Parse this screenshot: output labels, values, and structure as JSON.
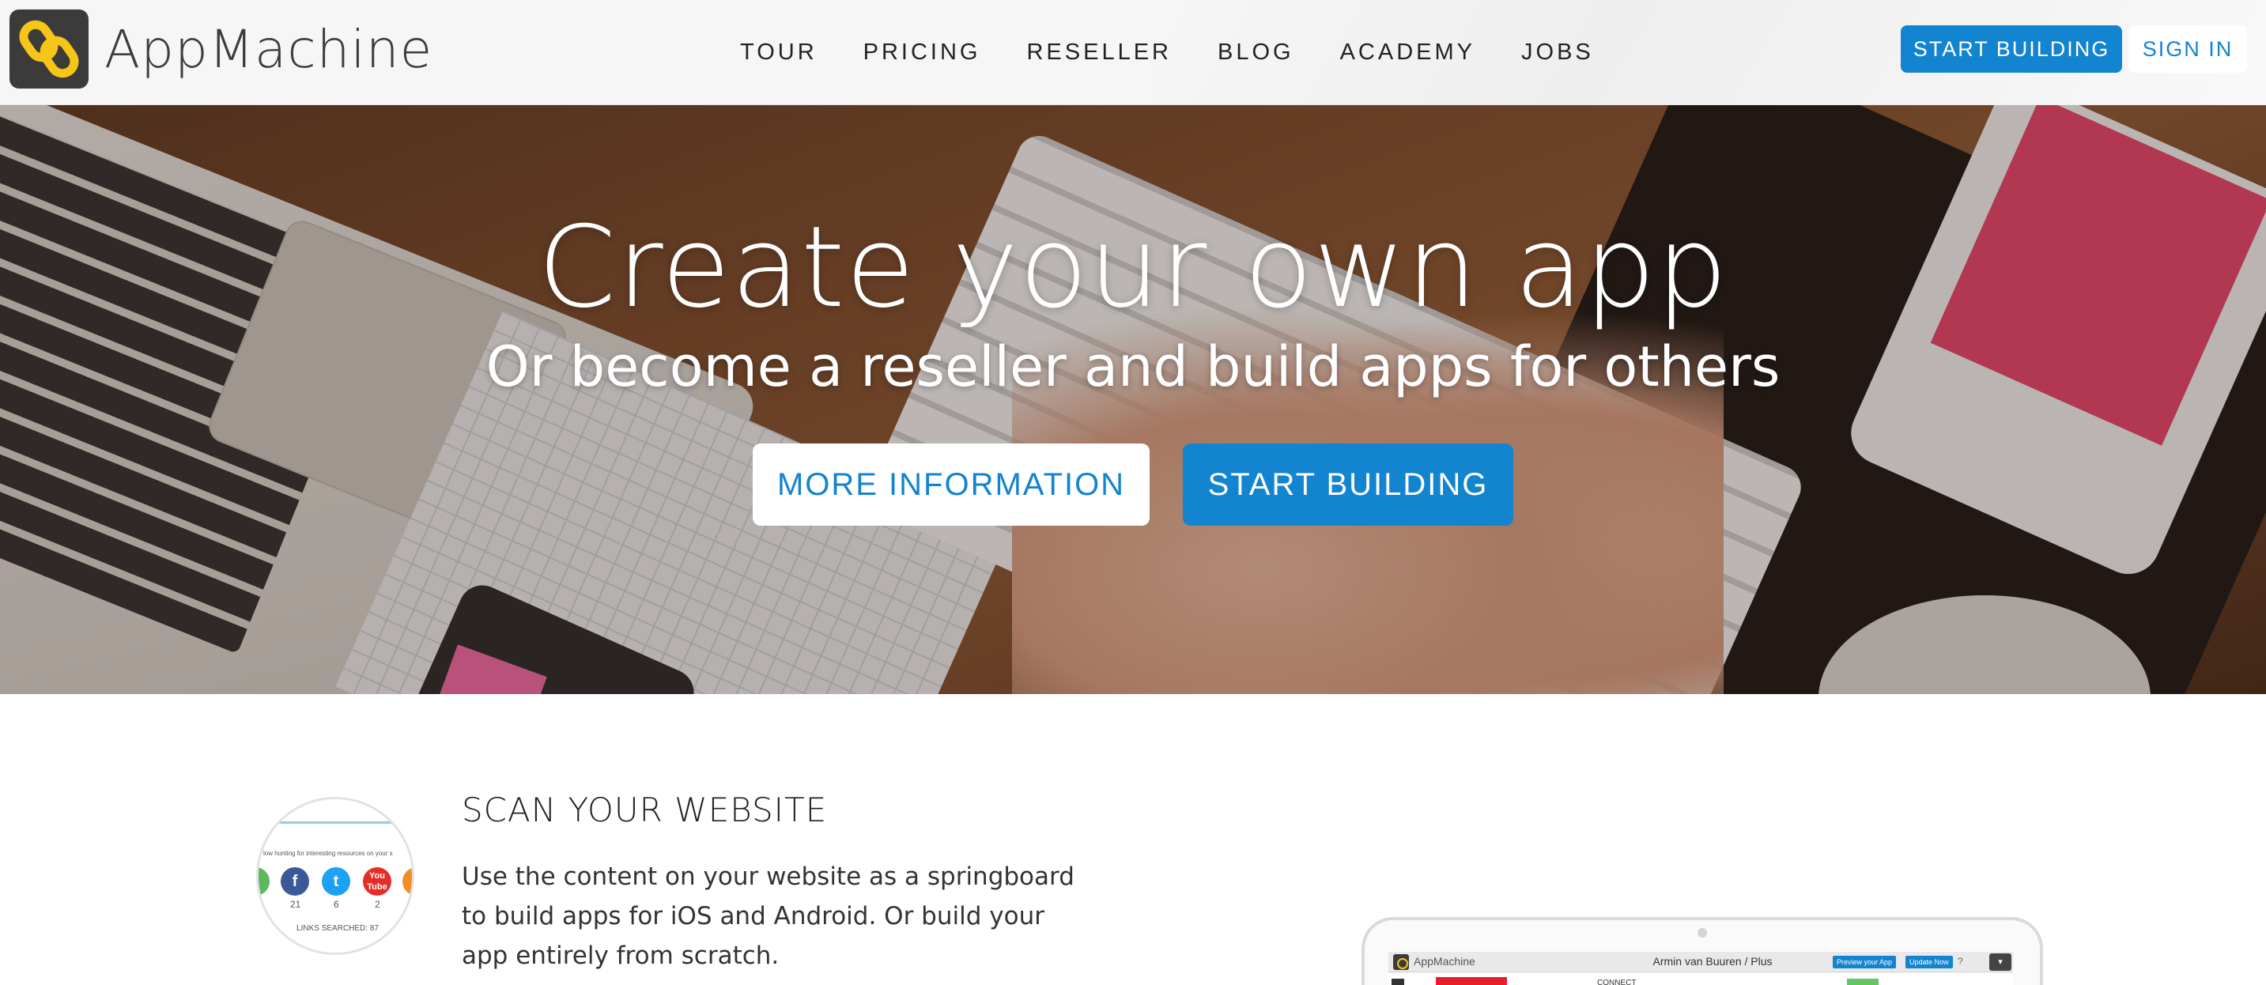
{
  "header": {
    "brand": "AppMachine",
    "nav": [
      "TOUR",
      "PRICING",
      "RESELLER",
      "BLOG",
      "ACADEMY",
      "JOBS"
    ],
    "start_building": "START BUILDING",
    "sign_in": "SIGN IN"
  },
  "hero": {
    "title": "Create your own app",
    "subtitle": "Or become a reseller and build apps for others",
    "more_information": "MORE INFORMATION",
    "start_building": "START BUILDING"
  },
  "feature": {
    "title": "SCAN YOUR WEBSITE",
    "body": "Use the content on your website as a springboard to build apps for iOS and Android. Or build your app entirely from scratch.",
    "thumb_text": "low hunting for interesting resources on your s",
    "counts": [
      "21",
      "6",
      "2"
    ],
    "links_searched": "LINKS SEARCHED: 87"
  },
  "device": {
    "app_name": "AppMachine",
    "project": "Armin van Buuren / Plus",
    "preview_btn": "Preview your App",
    "update_btn": "Update Now",
    "connect": "CONNECT"
  },
  "colors": {
    "accent": "#1384d0",
    "logo_bg": "#3b3b3b",
    "logo_mark": "#f5c518"
  },
  "icons": {
    "logo": "appmachine-chain-logo",
    "social": [
      "facebook-icon",
      "twitter-icon",
      "youtube-icon"
    ]
  }
}
